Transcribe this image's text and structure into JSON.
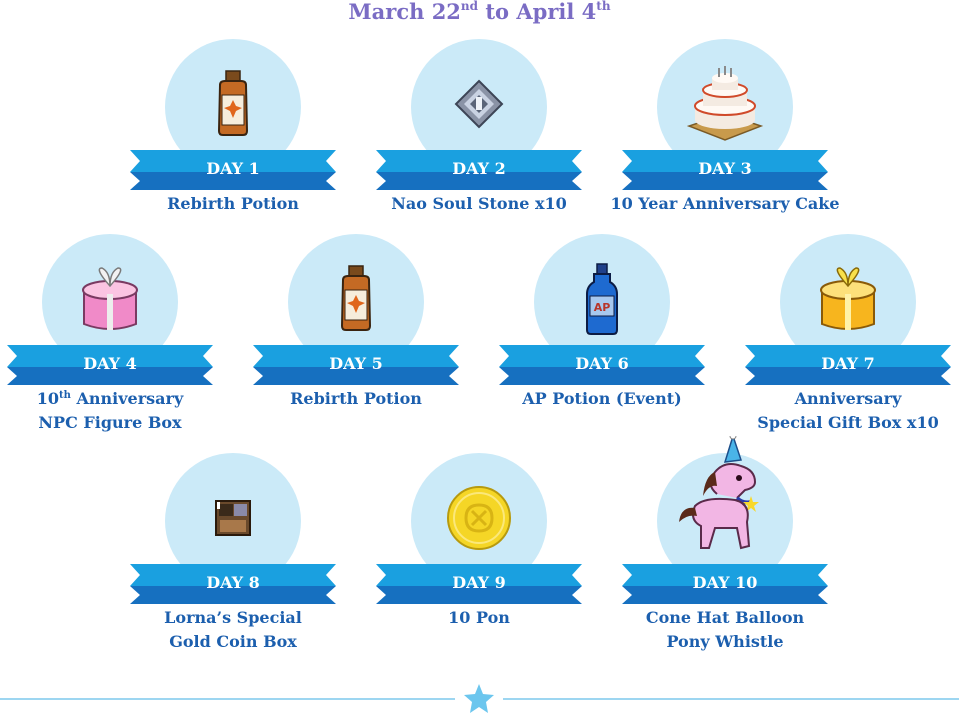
{
  "header": {
    "part1": "March 22",
    "sup1": "nd",
    "part2": " to April 4",
    "sup2": "th"
  },
  "colors": {
    "ribbon_front": "#1aa0e0",
    "ribbon_back": "#1670c0",
    "circle": "#cbeaf8",
    "name_text": "#1c5fae",
    "title_text": "#7a6cc4",
    "footer": "#9dd6f1",
    "star": "#6cc6ee"
  },
  "days": [
    {
      "label": "DAY 1",
      "item": "Rebirth Potion",
      "icon": "rebirth-potion-icon"
    },
    {
      "label": "DAY 2",
      "item": "Nao Soul Stone x10",
      "icon": "soul-stone-icon"
    },
    {
      "label": "DAY 3",
      "item": "10 Year Anniversary Cake",
      "icon": "anniversary-cake-icon"
    },
    {
      "label": "DAY 4",
      "item_prefix": "10",
      "item_sup": "th",
      "item_line1": " Anniversary",
      "item_line2": "NPC Figure Box",
      "icon": "pink-gift-box-icon"
    },
    {
      "label": "DAY 5",
      "item": "Rebirth Potion",
      "icon": "rebirth-potion-icon"
    },
    {
      "label": "DAY 6",
      "item": "AP Potion (Event)",
      "icon": "ap-potion-icon"
    },
    {
      "label": "DAY 7",
      "item_line1": "Anniversary",
      "item_line2": "Special Gift Box x10",
      "icon": "gold-gift-box-icon"
    },
    {
      "label": "DAY 8",
      "item_line1": "Lorna’s Special",
      "item_line2": "Gold Coin Box",
      "icon": "coin-box-icon"
    },
    {
      "label": "DAY 9",
      "item": "10 Pon",
      "icon": "pon-coin-icon"
    },
    {
      "label": "DAY 10",
      "item_line1": "Cone Hat Balloon",
      "item_line2": "Pony Whistle",
      "icon": "pony-balloon-icon"
    }
  ],
  "footer": {
    "icon": "star-icon"
  }
}
